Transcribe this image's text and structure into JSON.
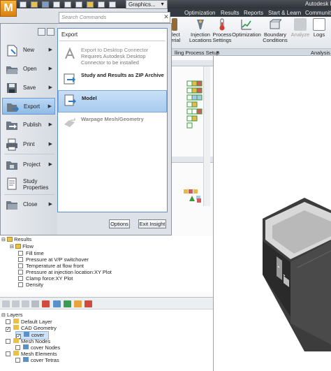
{
  "app": {
    "title": "Autodesk M",
    "menu_button": "M",
    "graphics_dropdown": "Graphics..."
  },
  "menu_tabs": [
    "Optimization",
    "Results",
    "Reports",
    "Start & Learn",
    "Community"
  ],
  "ribbon": {
    "buttons": [
      {
        "label": "elect\nterial",
        "icon": "material-icon"
      },
      {
        "label": "Injection\nLocations",
        "icon": "injection-locations-icon"
      },
      {
        "label": "Process\nSettings",
        "icon": "process-settings-icon"
      },
      {
        "label": "Optimization",
        "icon": "optimization-icon"
      },
      {
        "label": "Boundary\nConditions",
        "icon": "boundary-conditions-icon"
      },
      {
        "label": "Analyze",
        "icon": "analyze-icon"
      },
      {
        "label": "Logs",
        "icon": "logs-icon"
      }
    ],
    "group_label": "lling Process Setup",
    "group_label_2": "Analysis"
  },
  "search": {
    "placeholder": "Search Commands"
  },
  "app_menu": {
    "items": [
      {
        "label": "New",
        "icon": "new-icon",
        "arrow": "▶"
      },
      {
        "label": "Open",
        "icon": "open-folder-icon",
        "arrow": "▶"
      },
      {
        "label": "Save",
        "icon": "save-icon",
        "arrow": "▶"
      },
      {
        "label": "Export",
        "icon": "export-icon",
        "arrow": "▶",
        "selected": true
      },
      {
        "label": "Publish",
        "icon": "publish-icon",
        "arrow": "▶"
      },
      {
        "label": "Print",
        "icon": "print-icon",
        "arrow": "▶"
      },
      {
        "label": "Project",
        "icon": "project-icon",
        "arrow": "▶"
      },
      {
        "label": "Study\nProperties",
        "icon": "study-properties-icon",
        "arrow": ""
      },
      {
        "label": "Close",
        "icon": "close-folder-icon",
        "arrow": "▶"
      }
    ],
    "submenu": {
      "title": "Export",
      "items": [
        {
          "title": "Export to Desktop Connector",
          "desc": "Requires Autodesk Desktop\nConnector to be installed",
          "disabled": true,
          "icon": "desktop-connector-icon"
        },
        {
          "title": "Study and Results as ZIP Archive",
          "desc": "",
          "disabled": false,
          "icon": "zip-archive-icon"
        },
        {
          "title": "Model",
          "desc": "",
          "disabled": false,
          "selected": true,
          "icon": "model-export-icon"
        },
        {
          "title": "Warpage Mesh/Geometry",
          "desc": "",
          "disabled": true,
          "icon": "warpage-icon"
        }
      ]
    },
    "options_button": "Options",
    "exit_button": "Exit Insight"
  },
  "study_tree": {
    "results_label": "Results",
    "flow_label": "Flow",
    "items": [
      "Fill time",
      "Pressure at V/P switchover",
      "Temperature at flow front",
      "Pressure at injection location:XY Plot",
      "Clamp force:XY Plot",
      "Density"
    ]
  },
  "layers": {
    "title": "Layers",
    "items": [
      {
        "label": "Default Layer",
        "indent": 1,
        "checked": false
      },
      {
        "label": "CAD Geometry",
        "indent": 1,
        "checked": true
      },
      {
        "label": "cover",
        "indent": 2,
        "checked": true,
        "selected": true
      },
      {
        "label": "Mesh Nodes",
        "indent": 1,
        "checked": false
      },
      {
        "label": "cover Nodes",
        "indent": 2,
        "checked": false
      },
      {
        "label": "Mesh Elements",
        "indent": 1,
        "checked": false
      },
      {
        "label": "cover Tetras",
        "indent": 2,
        "checked": false
      }
    ]
  },
  "colors": {
    "accent": "#f0a22a",
    "selection": "#a7cbef",
    "menu_bg": "#dde2e8"
  }
}
